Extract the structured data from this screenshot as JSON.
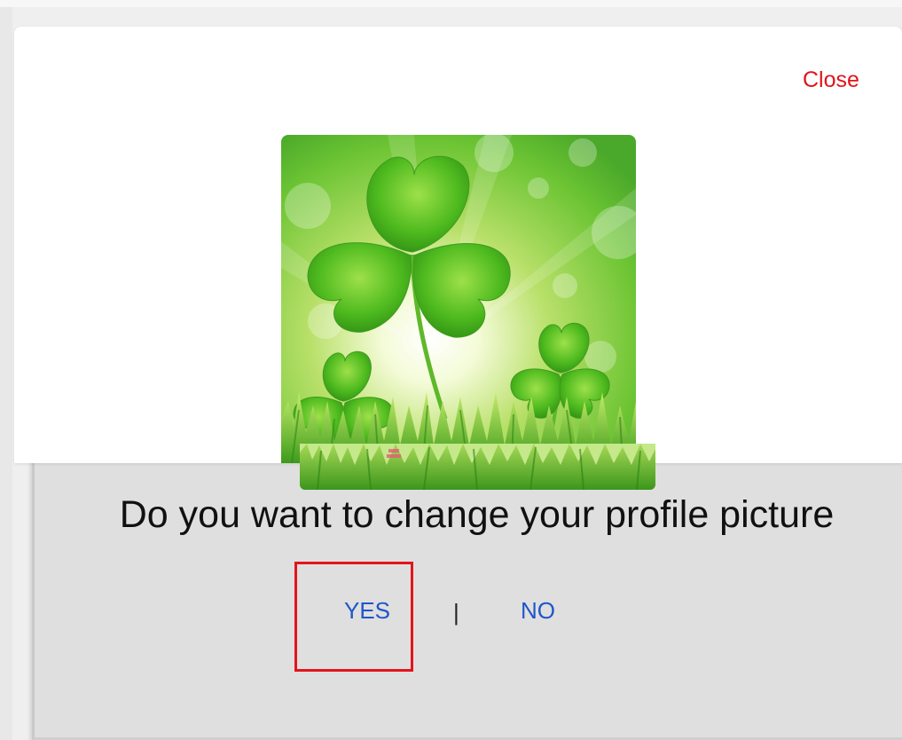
{
  "dialog": {
    "close_label": "Close",
    "question": "Do you want to change your profile picture",
    "yes_label": "YES",
    "separator": "|",
    "no_label": "NO"
  },
  "image": {
    "subject": "green shamrock clover leaves with grass on sunny bokeh background"
  },
  "colors": {
    "close": "#e0141b",
    "link": "#1f56c9",
    "highlight": "#e3141b",
    "panel": "#dfdfdf"
  }
}
